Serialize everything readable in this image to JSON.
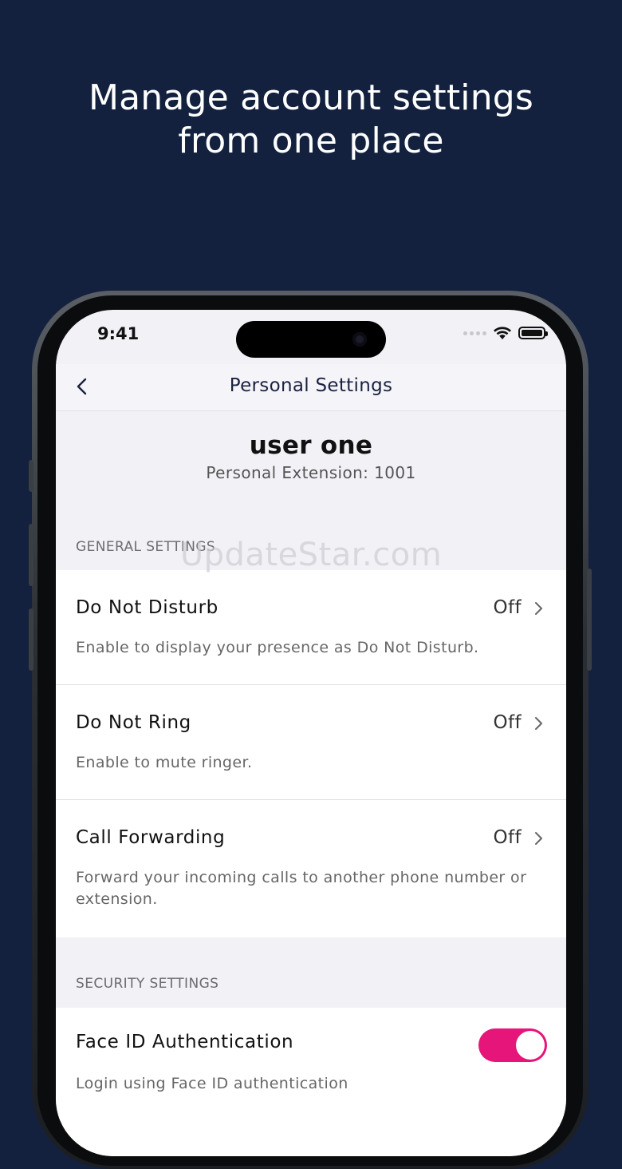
{
  "headline": {
    "line1": "Manage account settings",
    "line2": "from one place"
  },
  "status_bar": {
    "time": "9:41"
  },
  "nav": {
    "back_icon": "chevron-left-icon",
    "title": "Personal Settings"
  },
  "user": {
    "name": "user one",
    "extension": "Personal Extension: 1001"
  },
  "general_settings": {
    "label": "GENERAL SETTINGS",
    "items": [
      {
        "title": "Do Not Disturb",
        "value": "Off",
        "description": "Enable to display your presence as Do Not Disturb."
      },
      {
        "title": "Do Not Ring",
        "value": "Off",
        "description": "Enable to mute ringer."
      },
      {
        "title": "Call Forwarding",
        "value": "Off",
        "description": "Forward your incoming calls to another phone number or extension."
      }
    ]
  },
  "security_settings": {
    "label": "SECURITY SETTINGS",
    "face_id": {
      "title": "Face ID Authentication",
      "description": "Login using Face ID authentication",
      "enabled": true
    }
  },
  "watermark": "UpdateStar.com",
  "colors": {
    "background": "#13213f",
    "accent_toggle": "#e5157a",
    "nav_title": "#1a2240"
  }
}
